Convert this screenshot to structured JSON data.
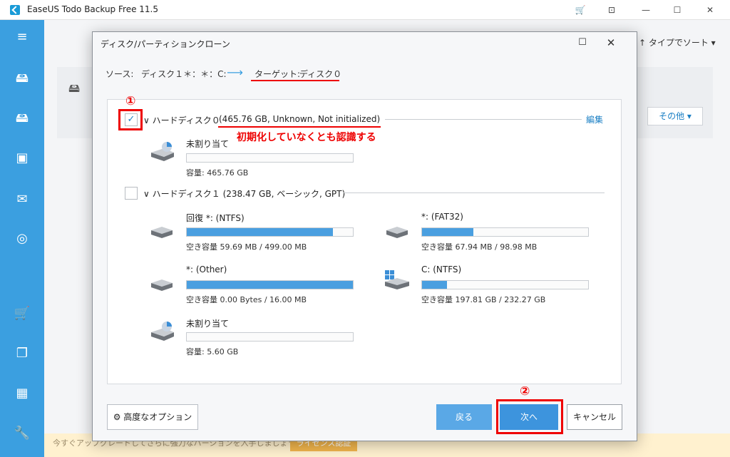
{
  "app": {
    "title": "EaseUS Todo Backup Free 11.5"
  },
  "window_controls": {
    "cart": "🛒",
    "pin": "⊡",
    "minimize": "—",
    "maximize": "☐",
    "close": "✕"
  },
  "sidebar": {
    "icons": [
      "menu-icon",
      "backup-disk-icon",
      "system-backup-icon",
      "file-backup-icon",
      "mail-backup-icon",
      "target-icon",
      "cart-icon",
      "clone-icon",
      "apps-icon",
      "tools-icon"
    ],
    "glyphs": [
      "≡",
      "🖴",
      "🖴",
      "▣",
      "✉",
      "◎",
      "🛒",
      "❐",
      "▦",
      "🔧"
    ]
  },
  "background": {
    "sort_label": "↑ タイプでソート ▾",
    "other_button": "その他 ▾",
    "banner_text": "今すぐアップグレードしてさらに強力なバージョンを入手しましょう。",
    "banner_button": "ライセンス認証"
  },
  "dialog": {
    "title": "ディスク/パーティションクローン",
    "maximize_glyph": "☐",
    "close_glyph": "✕",
    "source_label": "ソース:",
    "source_value": "ディスク１＊：＊：C:",
    "arrow": "⟶",
    "target_label": "ターゲット:",
    "target_value": "ディスク０",
    "annotation_1": "①",
    "annotation_2": "②",
    "annotation_text": "初期化していなくとも認識する",
    "edit_link": "編集",
    "check_glyph": "✓",
    "disks": [
      {
        "header": "∨ ハードディスク０",
        "detail": "(465.76 GB, Unknown, Not initialized)",
        "partitions": [
          {
            "name": "未割り当て",
            "info": "容量: 465.76 GB",
            "fill": 0
          }
        ]
      },
      {
        "header": "∨ ハードディスク１ (238.47 GB, ベーシック, GPT)",
        "partitions": [
          {
            "name": "回復 *: (NTFS)",
            "info": "空き容量 59.69 MB / 499.00 MB",
            "fill": 0.88
          },
          {
            "name": "*: (FAT32)",
            "info": "空き容量 67.94 MB / 98.98 MB",
            "fill": 0.31
          },
          {
            "name": "*: (Other)",
            "info": "空き容量 0.00 Bytes / 16.00 MB",
            "fill": 1.0
          },
          {
            "name": "C: (NTFS)",
            "info": "空き容量 197.81 GB / 232.27 GB",
            "fill": 0.15
          },
          {
            "name": "未割り当て",
            "info": "容量: 5.60 GB",
            "fill": 0
          }
        ]
      }
    ],
    "buttons": {
      "advanced": "⚙ 高度なオプション",
      "back": "戻る",
      "next": "次へ",
      "cancel": "キャンセル"
    }
  }
}
